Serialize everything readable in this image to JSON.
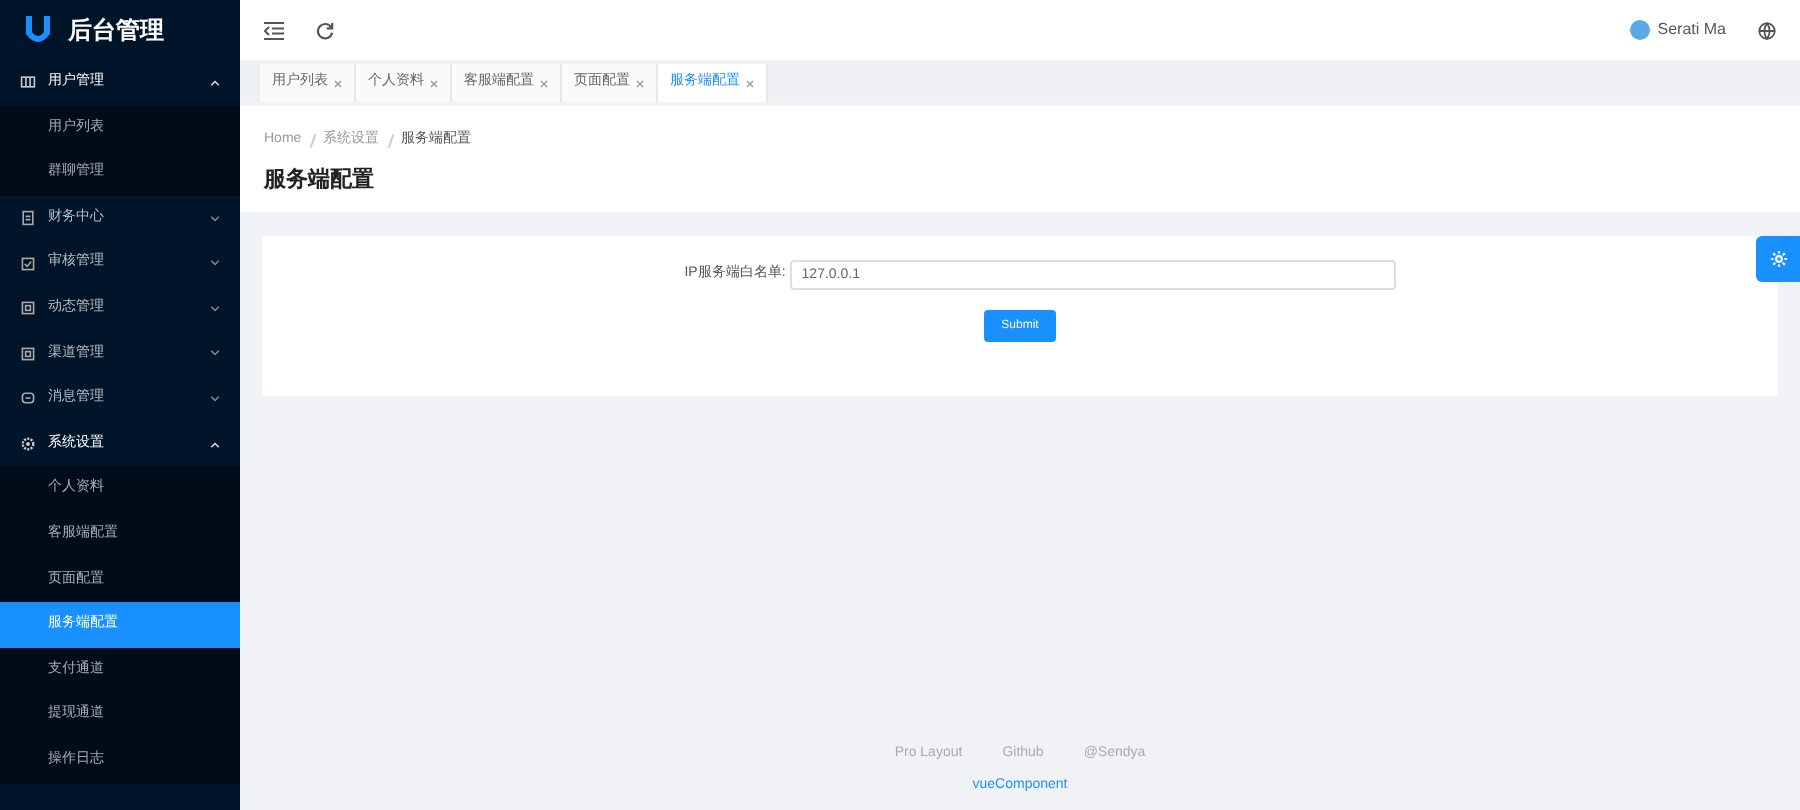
{
  "sidebar": {
    "title": "后台管理",
    "menus": [
      {
        "label": "用户管理",
        "expanded": true,
        "children": [
          {
            "label": "用户列表",
            "selected": false
          },
          {
            "label": "群聊管理",
            "selected": false
          }
        ]
      },
      {
        "label": "财务中心",
        "expanded": false
      },
      {
        "label": "审核管理",
        "expanded": false
      },
      {
        "label": "动态管理",
        "expanded": false
      },
      {
        "label": "渠道管理",
        "expanded": false
      },
      {
        "label": "消息管理",
        "expanded": false
      },
      {
        "label": "系统设置",
        "expanded": true,
        "children": [
          {
            "label": "个人资料",
            "selected": false
          },
          {
            "label": "客服端配置",
            "selected": false
          },
          {
            "label": "页面配置",
            "selected": false
          },
          {
            "label": "服务端配置",
            "selected": true
          },
          {
            "label": "支付通道",
            "selected": false
          },
          {
            "label": "提现通道",
            "selected": false
          },
          {
            "label": "操作日志",
            "selected": false
          }
        ]
      }
    ]
  },
  "header": {
    "user": "Serati Ma"
  },
  "tabs": [
    {
      "label": "用户列表",
      "selected": false
    },
    {
      "label": "个人资料",
      "selected": false
    },
    {
      "label": "客服端配置",
      "selected": false
    },
    {
      "label": "页面配置",
      "selected": false
    },
    {
      "label": "服务端配置",
      "selected": true
    }
  ],
  "breadcrumb": [
    "Home",
    "系统设置",
    "服务端配置"
  ],
  "page_title": "服务端配置",
  "form": {
    "label": "IP服务端白名单:",
    "value": "127.0.0.1",
    "submit": "Submit"
  },
  "footer": {
    "links": [
      "Pro Layout",
      "Github",
      "@Sendya"
    ],
    "copyright": "vueComponent"
  }
}
